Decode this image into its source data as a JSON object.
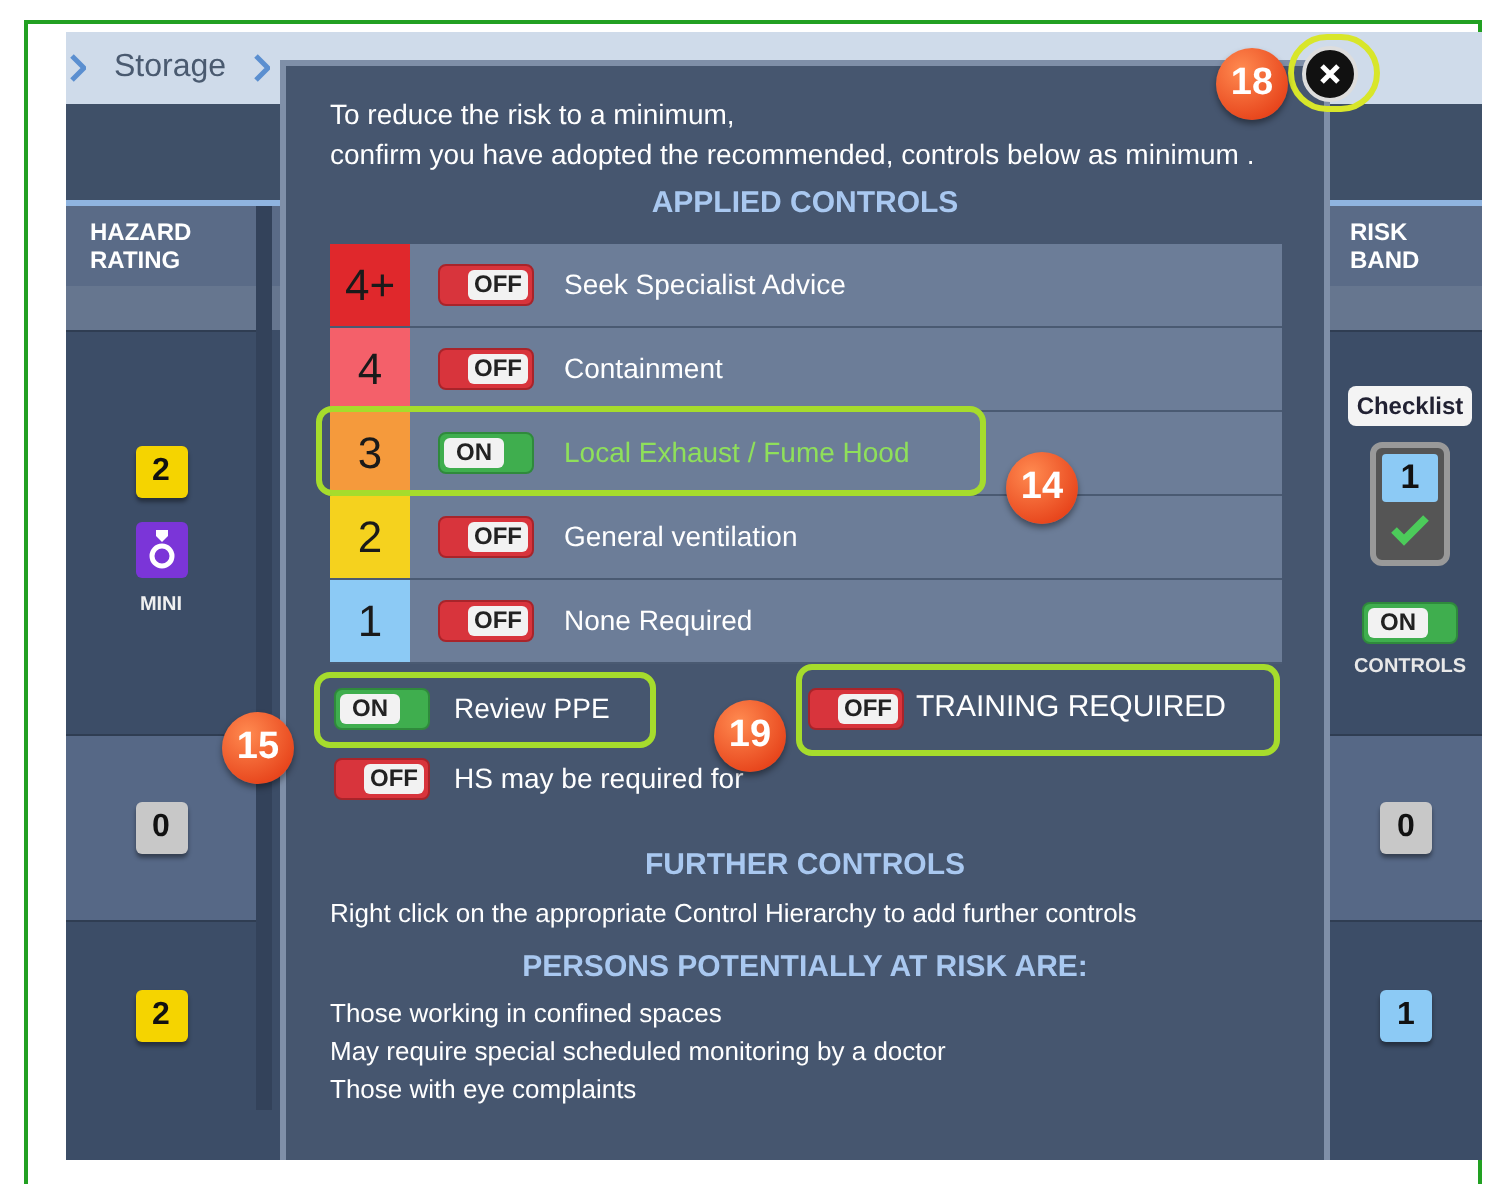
{
  "breadcrumb": [
    {
      "label": "Storage"
    }
  ],
  "table": {
    "columns": [
      {
        "label": "HAZARD RATING"
      },
      {
        "label": "RISK BAND"
      }
    ],
    "rows": [
      {
        "hazard": {
          "value": "2",
          "color": "#f5d400"
        },
        "hazard_icon": true,
        "hazard_tag": "MINI",
        "checklist": {
          "button": "Checklist",
          "band": "1",
          "color": "#8ccaf5",
          "checked": true
        },
        "controls_toggle": {
          "on": true,
          "label": "ON"
        },
        "controls_label": "CONTROLS"
      },
      {
        "hazard": {
          "value": "0",
          "color": "#c8c8c8"
        },
        "band": {
          "value": "0",
          "color": "#c8c8c8"
        }
      },
      {
        "hazard": {
          "value": "2",
          "color": "#f5d400"
        },
        "band": {
          "value": "1",
          "color": "#8ccaf5"
        }
      }
    ]
  },
  "dialog": {
    "intro": [
      "To reduce the risk to a minimum,",
      "confirm you have adopted the recommended, controls below as minimum ."
    ],
    "applied_title": "APPLIED CONTROLS",
    "controls": [
      {
        "level": "4+",
        "color": "#e0282c",
        "toggle": {
          "on": false,
          "label": "OFF"
        },
        "label": "Seek Specialist Advice",
        "highlighted": false
      },
      {
        "level": "4",
        "color": "#f4606a",
        "toggle": {
          "on": false,
          "label": "OFF"
        },
        "label": "Containment",
        "highlighted": false
      },
      {
        "level": "3",
        "color": "#f59a3c",
        "toggle": {
          "on": true,
          "label": "ON"
        },
        "label": "Local Exhaust / Fume Hood",
        "highlighted": true
      },
      {
        "level": "2",
        "color": "#f5d21e",
        "toggle": {
          "on": false,
          "label": "OFF"
        },
        "label": "General ventilation",
        "highlighted": false
      },
      {
        "level": "1",
        "color": "#8ccaf5",
        "toggle": {
          "on": false,
          "label": "OFF"
        },
        "label": "None Required",
        "highlighted": false
      }
    ],
    "review_ppe": {
      "toggle": {
        "on": true,
        "label": "ON"
      },
      "label": "Review PPE",
      "highlighted": true
    },
    "training": {
      "toggle": {
        "on": false,
        "label": "OFF"
      },
      "label": "TRAINING REQUIRED",
      "highlighted": true
    },
    "hs": {
      "toggle": {
        "on": false,
        "label": "OFF"
      },
      "label": "HS may be required for"
    },
    "further_title": "FURTHER CONTROLS",
    "further_text": "Right click on the appropriate Control Hierarchy to add further controls",
    "persons_title": "PERSONS POTENTIALLY AT RISK ARE:",
    "persons": [
      "Those working in confined spaces",
      "May require special scheduled monitoring by a doctor",
      "Those with eye complaints"
    ],
    "close_highlighted": true
  },
  "callouts": [
    {
      "number": "18"
    },
    {
      "number": "14"
    },
    {
      "number": "15"
    },
    {
      "number": "19"
    }
  ]
}
